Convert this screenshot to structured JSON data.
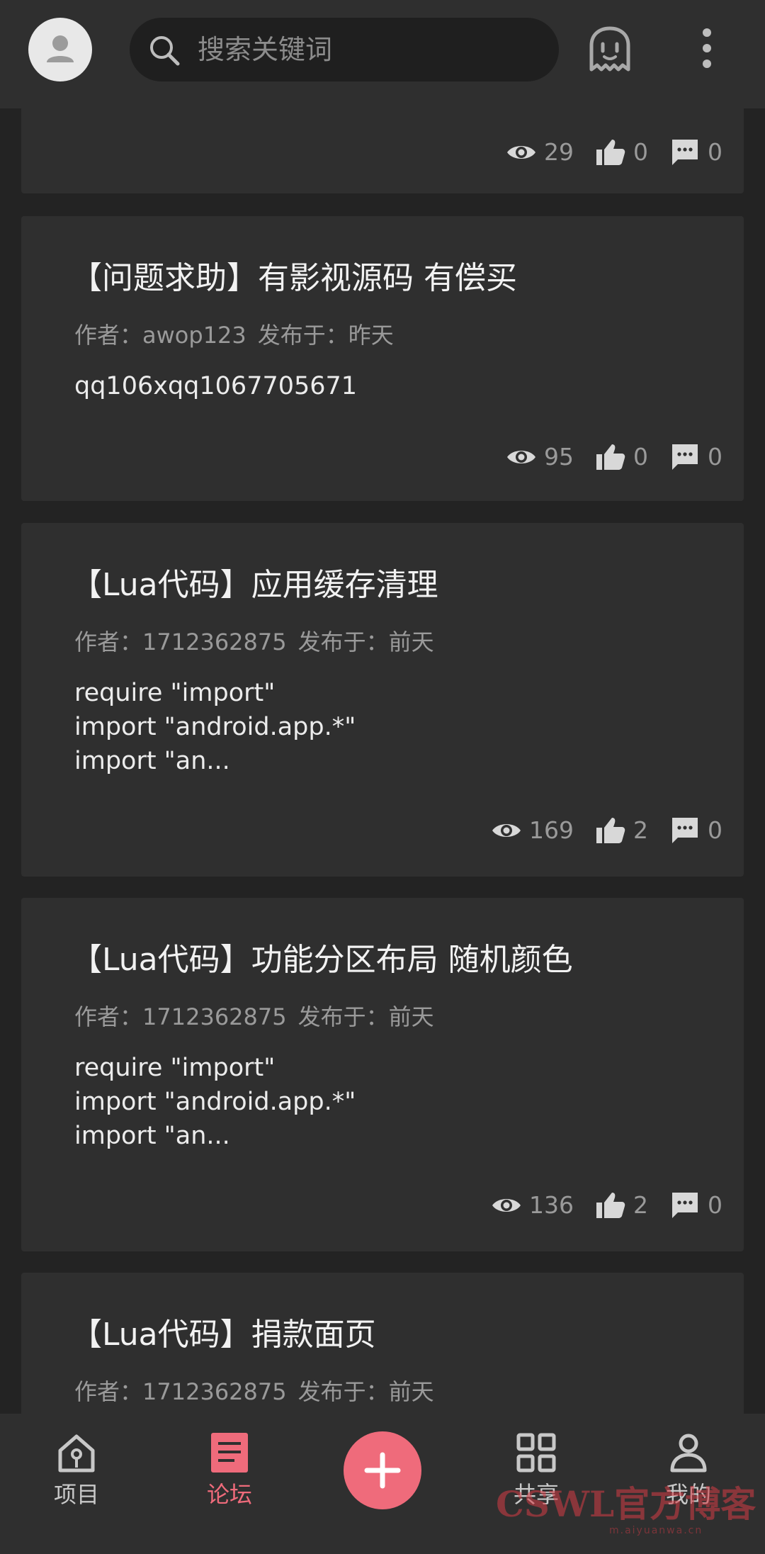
{
  "header": {
    "search_placeholder": "搜索关键词",
    "avatar_icon": "user-icon",
    "ghost_icon": "ghost-icon",
    "more_icon": "more-vert-icon"
  },
  "posts": [
    {
      "title": "",
      "author_label": "",
      "author": "",
      "date_label": "",
      "date": "",
      "body": "",
      "views": "29",
      "likes": "0",
      "comments": "0"
    },
    {
      "title": "【问题求助】有影视源码 有偿买",
      "author_label": "作者：",
      "author": "awop123",
      "date_label": "发布于：",
      "date": "昨天",
      "body": "qq106xqq1067705671",
      "views": "95",
      "likes": "0",
      "comments": "0"
    },
    {
      "title": "【Lua代码】应用缓存清理",
      "author_label": "作者：",
      "author": "1712362875",
      "date_label": "发布于：",
      "date": "前天",
      "body": "require \"import\"\nimport \"android.app.*\"\nimport \"an...",
      "views": "169",
      "likes": "2",
      "comments": "0"
    },
    {
      "title": "【Lua代码】功能分区布局 随机颜色",
      "author_label": "作者：",
      "author": "1712362875",
      "date_label": "发布于：",
      "date": "前天",
      "body": "require \"import\"\nimport \"android.app.*\"\nimport \"an...",
      "views": "136",
      "likes": "2",
      "comments": "0"
    },
    {
      "title": "【Lua代码】捐款面页",
      "author_label": "作者：",
      "author": "1712362875",
      "date_label": "发布于：",
      "date": "前天"
    }
  ],
  "nav": {
    "items": [
      {
        "label": "项目",
        "icon": "home-icon"
      },
      {
        "label": "论坛",
        "icon": "forum-icon"
      },
      {
        "label": "共享",
        "icon": "grid-icon"
      },
      {
        "label": "我的",
        "icon": "profile-icon"
      }
    ],
    "fab_icon": "plus-icon"
  },
  "watermark": {
    "text": "CSWL官方博客",
    "sub": "m.aiyuanwa.cn"
  },
  "colors": {
    "accent": "#ef6b7b",
    "background": "#232323",
    "surface": "#2f2f2f",
    "text_secondary": "#9a9a9a"
  }
}
